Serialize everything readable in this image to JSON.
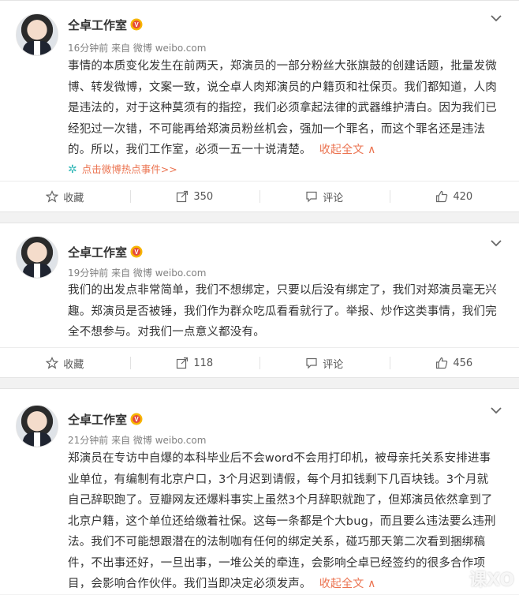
{
  "posts": [
    {
      "author": "仝卓工作室",
      "meta": "16分钟前 来自 微博 weibo.com",
      "content": "事情的本质变化发生在前两天，郑演员的一部分粉丝大张旗鼓的创建话题，批量发微博、转发微博，文案一致，说仝卓人肉郑演员的户籍页和社保页。我们都知道，人肉是违法的，对于这种莫须有的指控，我们必须拿起法律的武器维护清白。因为我们已经犯过一次错，不可能再给郑演员粉丝机会，强加一个罪名，而这个罪名还是违法的。所以，我们工作室，必须一五一十说清楚。",
      "collapse": "收起全文 ∧",
      "hot": "点击微博热点事件>>",
      "actions": {
        "fav": "收藏",
        "repost": "350",
        "comment": "评论",
        "like": "420"
      }
    },
    {
      "author": "仝卓工作室",
      "meta": "19分钟前 来自 微博 weibo.com",
      "content": "我们的出发点非常简单，我们不想绑定，只要以后没有绑定了，我们对郑演员毫无兴趣。郑演员是否被锤，我们作为群众吃瓜看看就行了。举报、炒作这类事情，我们完全不想参与。对我们一点意义都没有。",
      "actions": {
        "fav": "收藏",
        "repost": "118",
        "comment": "评论",
        "like": "456"
      }
    },
    {
      "author": "仝卓工作室",
      "meta": "21分钟前 来自 微博 weibo.com",
      "content": "郑演员在专访中自爆的本科毕业后不会word不会用打印机，被母亲托关系安排进事业单位，有编制有北京户口，3个月迟到请假，每个月扣钱剩下几百块钱。3个月就自己辞职跑了。豆瓣网友还爆料事实上虽然3个月辞职就跑了，但郑演员依然拿到了北京户籍，这个单位还给缴着社保。这每一条都是个大bug，而且要么违法要么违刑法。我们不可能想跟潜在的法制咖有任何的绑定关系，碰巧那天第二次看到捆绑稿件，不出事还好，一旦出事，一堆公关的牵连，会影响仝卓已经签约的很多合作项目，会影响合作伙伴。我们当即决定必须发声。",
      "collapse": "收起全文 ∧"
    }
  ],
  "watermark": "课XO",
  "colors": {
    "accent": "#eb7350",
    "hot_icon": "#2fb7b7",
    "bg": "#f2f2f2"
  }
}
